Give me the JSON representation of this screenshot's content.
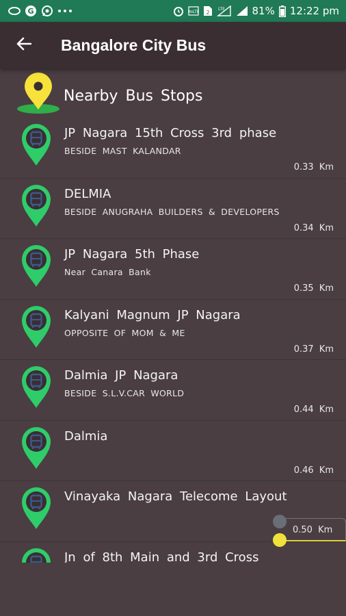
{
  "status_bar": {
    "battery": "81%",
    "time": "12:22 pm",
    "icons": [
      "chat-bubble-icon",
      "g-circle-icon",
      "whatsapp-icon",
      "more-dots-icon",
      "alarm-icon",
      "volte-icon",
      "sim2-icon",
      "lte-signal-icon",
      "signal-icon",
      "battery-icon"
    ]
  },
  "app_bar": {
    "title": "Bangalore City Bus",
    "back_icon": "arrow-left-icon"
  },
  "section": {
    "title": "Nearby Bus Stops",
    "icon": "location-pin-icon",
    "pin_color": "#f6e23a",
    "pin_base_color": "#2fae4a"
  },
  "stops": [
    {
      "name": "JP Nagara 15th Cross 3rd phase",
      "description": "BESIDE MAST KALANDAR",
      "distance": "0.33 Km"
    },
    {
      "name": "DELMIA",
      "description": "BESIDE ANUGRAHA BUILDERS & DEVELOPERS",
      "distance": "0.34 Km"
    },
    {
      "name": "JP Nagara 5th Phase",
      "description": "Near Canara Bank",
      "distance": "0.35 Km"
    },
    {
      "name": "Kalyani Magnum JP Nagara",
      "description": "OPPOSITE OF MOM & ME",
      "distance": "0.37 Km"
    },
    {
      "name": "Dalmia JP Nagara",
      "description": "BESIDE S.L.V.CAR WORLD",
      "distance": "0.44 Km"
    },
    {
      "name": "Dalmia",
      "description": "",
      "distance": "0.46 Km"
    },
    {
      "name": "Vinayaka Nagara Telecome Layout",
      "description": "",
      "distance": ""
    },
    {
      "name": "Jn of 8th Main and 3rd Cross",
      "description": "",
      "distance": ""
    }
  ],
  "scroll_indicator": {
    "label": "0.50 Km"
  },
  "colors": {
    "status_bar": "#1f7a55",
    "app_bar": "#3a2e33",
    "background": "#4a3e42",
    "bus_pin": "#2fcc6a",
    "bus_icon": "#3b5a8c"
  }
}
